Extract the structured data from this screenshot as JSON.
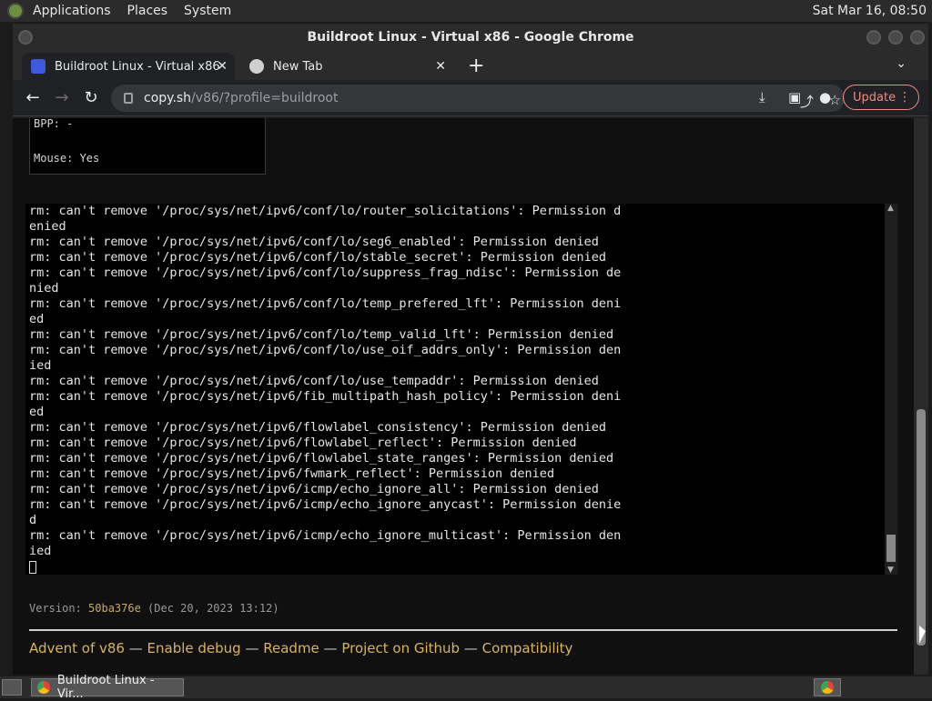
{
  "panel": {
    "menus": [
      "Applications",
      "Places",
      "System"
    ],
    "clock": "Sat Mar 16, 08:50"
  },
  "window": {
    "title": "Buildroot Linux - Virtual x86 - Google Chrome"
  },
  "tabs": [
    {
      "label": "Buildroot Linux - Virtual x86",
      "close": "✕"
    },
    {
      "label": "New Tab",
      "close": "✕"
    }
  ],
  "tab_add": "+",
  "tab_list": "⌄",
  "toolbar": {
    "back": "←",
    "forward": "→",
    "reload": "↻",
    "url_host": "copy.sh",
    "url_path": "/v86/?profile=buildroot",
    "share": "⤴",
    "star": "☆",
    "download": "⤓",
    "side_panel": "▣",
    "profile": "●",
    "update_label": "Update",
    "menu": "⋮"
  },
  "info_box": {
    "bpp": "BPP: -",
    "mouse": "Mouse: Yes"
  },
  "terminal": {
    "lines": [
      "rm: can't remove '/proc/sys/net/ipv6/conf/lo/router_solicitations': Permission d",
      "enied",
      "rm: can't remove '/proc/sys/net/ipv6/conf/lo/seg6_enabled': Permission denied",
      "rm: can't remove '/proc/sys/net/ipv6/conf/lo/stable_secret': Permission denied",
      "rm: can't remove '/proc/sys/net/ipv6/conf/lo/suppress_frag_ndisc': Permission de",
      "nied",
      "rm: can't remove '/proc/sys/net/ipv6/conf/lo/temp_prefered_lft': Permission deni",
      "ed",
      "rm: can't remove '/proc/sys/net/ipv6/conf/lo/temp_valid_lft': Permission denied",
      "rm: can't remove '/proc/sys/net/ipv6/conf/lo/use_oif_addrs_only': Permission den",
      "ied",
      "rm: can't remove '/proc/sys/net/ipv6/conf/lo/use_tempaddr': Permission denied",
      "rm: can't remove '/proc/sys/net/ipv6/fib_multipath_hash_policy': Permission deni",
      "ed",
      "rm: can't remove '/proc/sys/net/ipv6/flowlabel_consistency': Permission denied",
      "rm: can't remove '/proc/sys/net/ipv6/flowlabel_reflect': Permission denied",
      "rm: can't remove '/proc/sys/net/ipv6/flowlabel_state_ranges': Permission denied",
      "rm: can't remove '/proc/sys/net/ipv6/fwmark_reflect': Permission denied",
      "rm: can't remove '/proc/sys/net/ipv6/icmp/echo_ignore_all': Permission denied",
      "rm: can't remove '/proc/sys/net/ipv6/icmp/echo_ignore_anycast': Permission denie",
      "d",
      "rm: can't remove '/proc/sys/net/ipv6/icmp/echo_ignore_multicast': Permission den",
      "ied"
    ]
  },
  "version": {
    "prefix": "Version: ",
    "hash": "50ba376e",
    "date": " (Dec 20, 2023 13:12)"
  },
  "footer": {
    "links": [
      "Advent of v86",
      "Enable debug",
      "Readme",
      "Project on Github",
      "Compatibility"
    ],
    "separator": " — "
  },
  "taskbar": {
    "task_label": "Buildroot Linux - Vir..."
  }
}
